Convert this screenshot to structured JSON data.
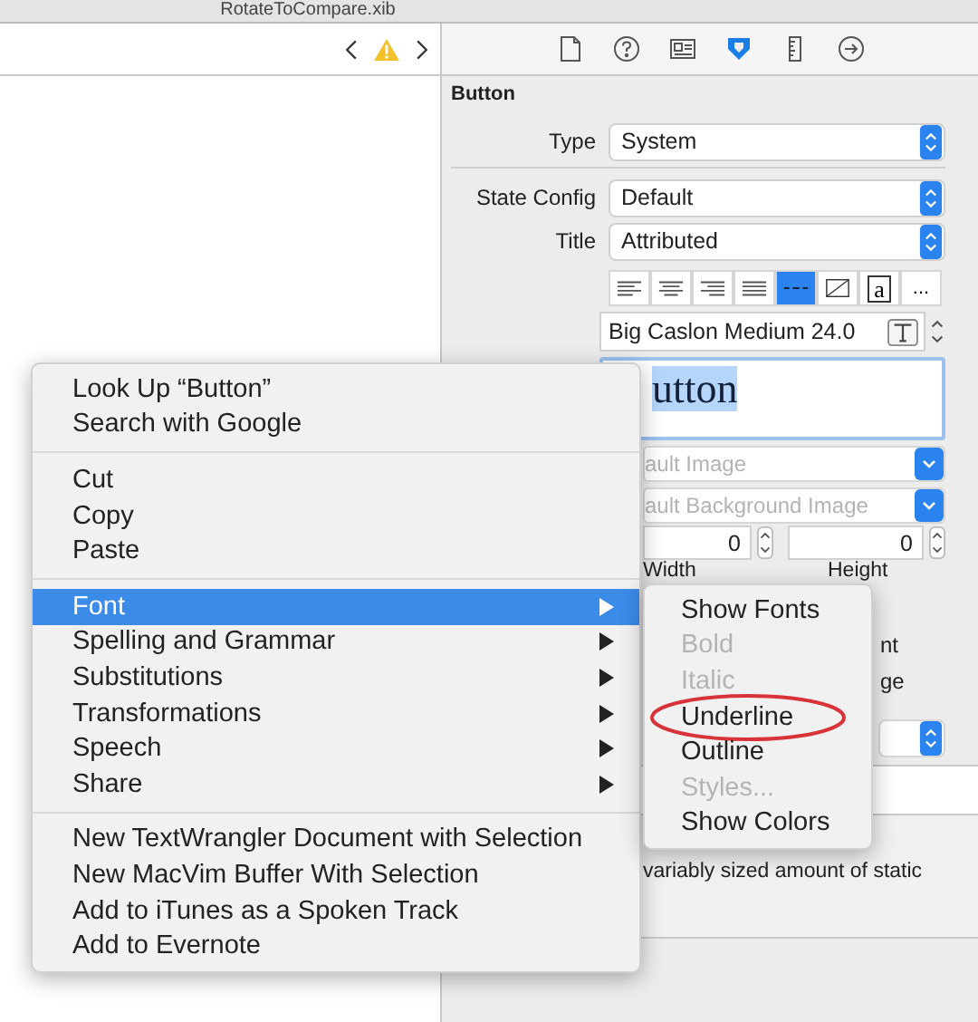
{
  "window": {
    "title": "RotateToCompare.xib"
  },
  "inspector_tabs": [
    {
      "kind": "file",
      "selected": false
    },
    {
      "kind": "help",
      "selected": false
    },
    {
      "kind": "identity",
      "selected": false
    },
    {
      "kind": "attributes",
      "selected": true
    },
    {
      "kind": "size",
      "selected": false
    },
    {
      "kind": "connections",
      "selected": false
    }
  ],
  "inspector": {
    "heading": "Button",
    "rows": [
      {
        "label": "Type",
        "value": "System"
      },
      {
        "label": "State Config",
        "value": "Default"
      },
      {
        "label": "Title",
        "value": "Attributed"
      }
    ],
    "format_buttons": [
      {
        "kind": "align-left",
        "selected": false
      },
      {
        "kind": "align-center",
        "selected": false
      },
      {
        "kind": "align-right",
        "selected": false
      },
      {
        "kind": "justify",
        "selected": false
      },
      {
        "kind": "spacing",
        "selected": true
      },
      {
        "kind": "strike",
        "selected": false
      },
      {
        "kind": "letter",
        "label": "a",
        "selected": false
      },
      {
        "kind": "more",
        "label": "...",
        "selected": false
      }
    ],
    "font": "Big Caslon Medium 24.0",
    "preview_text": "utton",
    "image_field": "ault Image",
    "background_field": "ault Background Image",
    "width": {
      "value": "0",
      "label": "Width"
    },
    "height": {
      "value": "0",
      "label": "Height"
    },
    "fragments": [
      "nt",
      "ge"
    ],
    "description": "variably sized amount of static"
  },
  "context_menu": {
    "groups": [
      [
        {
          "label": "Look Up “Button”",
          "has_submenu": false,
          "selected": false
        },
        {
          "label": "Search with Google",
          "has_submenu": false,
          "selected": false
        }
      ],
      [
        {
          "label": "Cut",
          "has_submenu": false,
          "selected": false
        },
        {
          "label": "Copy",
          "has_submenu": false,
          "selected": false
        },
        {
          "label": "Paste",
          "has_submenu": false,
          "selected": false
        }
      ],
      [
        {
          "label": "Font",
          "has_submenu": true,
          "selected": true
        },
        {
          "label": "Spelling and Grammar",
          "has_submenu": true,
          "selected": false
        },
        {
          "label": "Substitutions",
          "has_submenu": true,
          "selected": false
        },
        {
          "label": "Transformations",
          "has_submenu": true,
          "selected": false
        },
        {
          "label": "Speech",
          "has_submenu": true,
          "selected": false
        },
        {
          "label": "Share",
          "has_submenu": true,
          "selected": false
        }
      ],
      [
        {
          "label": "New TextWrangler Document with Selection",
          "has_submenu": false,
          "selected": false
        },
        {
          "label": "New MacVim Buffer With Selection",
          "has_submenu": false,
          "selected": false
        },
        {
          "label": "Add to iTunes as a Spoken Track",
          "has_submenu": false,
          "selected": false
        },
        {
          "label": "Add to Evernote",
          "has_submenu": false,
          "selected": false
        }
      ]
    ]
  },
  "font_submenu": {
    "items": [
      {
        "label": "Show Fonts",
        "disabled": false,
        "circled": false
      },
      {
        "label": "Bold",
        "disabled": true,
        "circled": false
      },
      {
        "label": "Italic",
        "disabled": true,
        "circled": false
      },
      {
        "label": "Underline",
        "disabled": false,
        "circled": true
      },
      {
        "label": "Outline",
        "disabled": false,
        "circled": false
      },
      {
        "label": "Styles...",
        "disabled": true,
        "circled": false
      },
      {
        "label": "Show Colors",
        "disabled": false,
        "circled": false
      }
    ]
  }
}
